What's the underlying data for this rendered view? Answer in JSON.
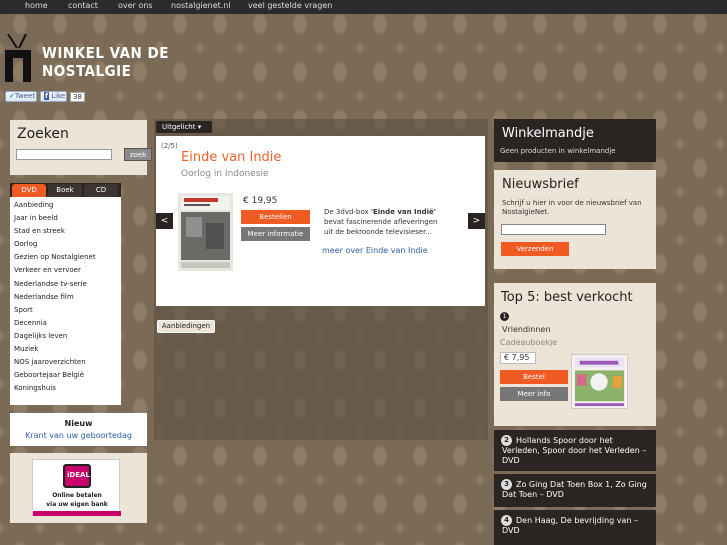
{
  "nav": [
    "home",
    "contact",
    "over ons",
    "nostalgienet.nl",
    "veel gestelde vragen"
  ],
  "logo": {
    "line1": "WINKEL VAN DE",
    "line2": "NOSTALGIE"
  },
  "social": {
    "tweet": "Tweet",
    "like": "Like",
    "like_count": "38"
  },
  "search": {
    "title": "Zoeken",
    "value": "",
    "button": "zoek"
  },
  "category_tabs": [
    "DVD",
    "Boek",
    "CD"
  ],
  "categories": [
    "Aanbieding",
    "Jaar in beeld",
    "Stad en streek",
    "Oorlog",
    "Gezien op Nostalgienet",
    "Verkeer en vervoer",
    "Nederlandse tv-serie",
    "Nederlandse film",
    "Sport",
    "Decennia",
    "Dagelijks leven",
    "Muziek",
    "NOS jaaroverzichten",
    "Geboortejaar België",
    "Koningshuis"
  ],
  "nieuw": {
    "label": "Nieuw",
    "link": "Krant van uw geboortedag"
  },
  "ideal": {
    "logo_text": "iDEAL",
    "line1": "Online betalen",
    "line2": "via uw eigen bank"
  },
  "featured": {
    "dropdown": "Uitgelicht ▾",
    "counter": "(2/5)",
    "title": "Einde van Indie",
    "subtitle": "Oorlog in Indonesie",
    "price": "€ 19,95",
    "order": "Bestellen",
    "info": "Meer informatie",
    "desc_pre": "De 3dvd-box ",
    "desc_bold": "'Einde van Indië'",
    "desc_post": " bevat fascinerende afleveringen uit de bekroonde televisieser...",
    "more": "meer over Einde van Indie",
    "prev": "<",
    "next": ">"
  },
  "aanbiedingen": "Aanbiedingen",
  "cart": {
    "title": "Winkelmandje",
    "empty": "Geen producten in winkelmandje"
  },
  "newsletter": {
    "title": "Nieuwsbrief",
    "text": "Schrijf u hier in voor de nieuwsbrief van NostalgieNet.",
    "button": "Verzenden"
  },
  "top5": {
    "title": "Top 5: best verkocht",
    "first": {
      "num": "1",
      "name": "Vriendinnen",
      "category": "Cadeauboekje",
      "price": "€ 7,95",
      "order": "Bestel",
      "info": "Meer info"
    },
    "rest": [
      {
        "num": "2",
        "text": "Hollands Spoor door het Verleden, Spoor door het Verleden – DVD"
      },
      {
        "num": "3",
        "text": "Zo Ging Dat Toen Box 1, Zo Ging Dat Toen – DVD"
      },
      {
        "num": "4",
        "text": "Den Haag, De bevrijding van – DVD"
      }
    ]
  },
  "colors": {
    "accent": "#f05a23",
    "link": "#2a5fa3",
    "dark": "#2a2522",
    "panel": "#ece4d6"
  }
}
